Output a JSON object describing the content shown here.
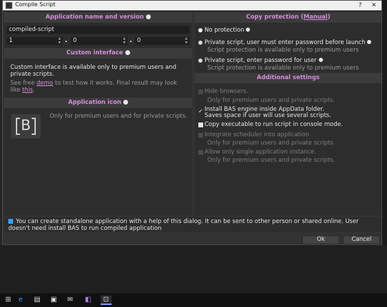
{
  "window": {
    "title": "Compile Script",
    "help_glyph": "?",
    "close_glyph": "✕"
  },
  "left": {
    "app_name_header": "Application name and version",
    "app_name_value": "compiled-script",
    "version": [
      "1",
      "0",
      "0"
    ],
    "version_sep": ".",
    "custom_interface_header": "Custom interface",
    "custom_interface_text": "Custom interface is available only to premium users and private scripts.",
    "see_free_prefix": "See free ",
    "demo_link": "demo",
    "see_free_suffix": " to test how it works. Final result may look like",
    "this_link": "this",
    "this_suffix": ".",
    "app_icon_header": "Application icon",
    "app_icon_letter": "B",
    "app_icon_note": "Only for premium users and for private scripts."
  },
  "right": {
    "copy_protection_prefix": "Copy protection (",
    "copy_protection_link": "Manual",
    "copy_protection_suffix": ")",
    "opt_no_protection": "No protection",
    "opt_password_launch": "Private script, user must enter password before launch",
    "opt_password_launch_note": "Script protection is available only to premium users",
    "opt_password_user": "Private script, enter password for user",
    "opt_password_user_note": "Script protection is available only to premium users",
    "additional_header": "Additional settings",
    "hide_browsers": "Hide browsers.",
    "hide_browsers_note": "Only for premium users and private scripts.",
    "install_bas": "Install BAS engine inside AppData folder.",
    "install_bas_note": "Saves space if user will use several scripts.",
    "copy_exe": "Copy executable to run script in console mode.",
    "integrate_scheduler": "Integrate scheduler into application",
    "integrate_scheduler_note": "Only for premium users and private scripts.",
    "single_instance": "Allow only single application instance.",
    "single_instance_note": "Only for premium users and private scripts."
  },
  "footer": {
    "message": "You can create standalone application with a help of this dialog. It can be sent to other person or shared online. User doesn't need install BAS to run compiled application",
    "ok_label": "Ok",
    "cancel_label": "Cancel"
  },
  "colors": {
    "accent": "#d58ddc",
    "panel": "#2d2d2d",
    "header": "#3b3b3b"
  }
}
